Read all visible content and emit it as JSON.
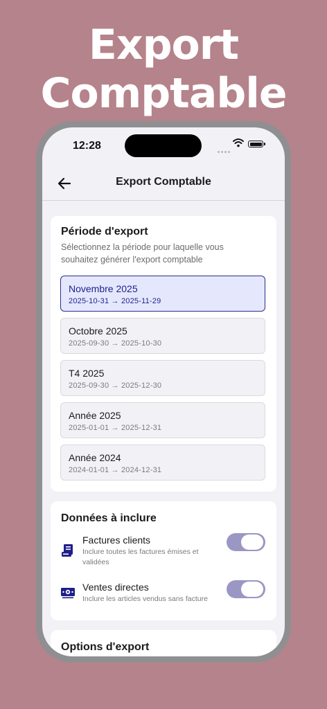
{
  "headline": {
    "line1": "Export",
    "line2": "Comptable"
  },
  "status_bar": {
    "time": "12:28"
  },
  "navbar": {
    "title": "Export Comptable"
  },
  "period_section": {
    "title": "Période d'export",
    "subtitle": "Sélectionnez la période pour laquelle vous souhaitez générer l'export comptable",
    "items": [
      {
        "name": "Novembre 2025",
        "range": "2025-10-31 → 2025-11-29",
        "selected": true
      },
      {
        "name": "Octobre 2025",
        "range": "2025-09-30 → 2025-10-30",
        "selected": false
      },
      {
        "name": "T4 2025",
        "range": "2025-09-30 → 2025-12-30",
        "selected": false
      },
      {
        "name": "Année 2025",
        "range": "2025-01-01 → 2025-12-31",
        "selected": false
      },
      {
        "name": "Année 2024",
        "range": "2024-01-01 → 2024-12-31",
        "selected": false
      }
    ]
  },
  "data_section": {
    "title": "Données à inclure",
    "options": [
      {
        "icon": "invoice-icon",
        "title": "Factures clients",
        "description": "Inclure toutes les factures émises et validées",
        "enabled": true
      },
      {
        "icon": "cash-icon",
        "title": "Ventes directes",
        "description": "Inclure les articles vendus sans facture",
        "enabled": true
      }
    ]
  },
  "export_options": {
    "title": "Options d'export"
  },
  "colors": {
    "background": "#b5838b",
    "accent": "#1e1f8a",
    "selected_bg": "#e5e8fd",
    "toggle_on": "#9a97c4"
  }
}
